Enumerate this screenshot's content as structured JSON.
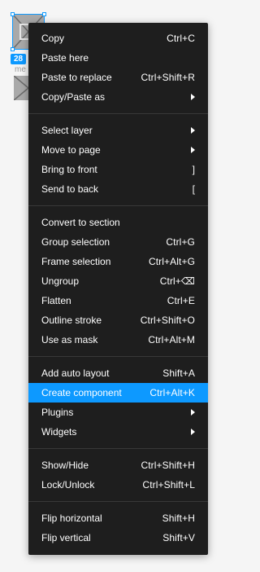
{
  "canvas": {
    "size_badge": "28",
    "layer_label": "me"
  },
  "menu": {
    "groups": [
      [
        {
          "label": "Copy",
          "shortcut": "Ctrl+C"
        },
        {
          "label": "Paste here",
          "shortcut": ""
        },
        {
          "label": "Paste to replace",
          "shortcut": "Ctrl+Shift+R"
        },
        {
          "label": "Copy/Paste as",
          "submenu": true
        }
      ],
      [
        {
          "label": "Select layer",
          "submenu": true
        },
        {
          "label": "Move to page",
          "submenu": true
        },
        {
          "label": "Bring to front",
          "shortcut": "]"
        },
        {
          "label": "Send to back",
          "shortcut": "["
        }
      ],
      [
        {
          "label": "Convert to section",
          "shortcut": ""
        },
        {
          "label": "Group selection",
          "shortcut": "Ctrl+G"
        },
        {
          "label": "Frame selection",
          "shortcut": "Ctrl+Alt+G"
        },
        {
          "label": "Ungroup",
          "shortcut": "Ctrl+⌫"
        },
        {
          "label": "Flatten",
          "shortcut": "Ctrl+E"
        },
        {
          "label": "Outline stroke",
          "shortcut": "Ctrl+Shift+O"
        },
        {
          "label": "Use as mask",
          "shortcut": "Ctrl+Alt+M"
        }
      ],
      [
        {
          "label": "Add auto layout",
          "shortcut": "Shift+A"
        },
        {
          "label": "Create component",
          "shortcut": "Ctrl+Alt+K",
          "highlighted": true
        },
        {
          "label": "Plugins",
          "submenu": true
        },
        {
          "label": "Widgets",
          "submenu": true
        }
      ],
      [
        {
          "label": "Show/Hide",
          "shortcut": "Ctrl+Shift+H"
        },
        {
          "label": "Lock/Unlock",
          "shortcut": "Ctrl+Shift+L"
        }
      ],
      [
        {
          "label": "Flip horizontal",
          "shortcut": "Shift+H"
        },
        {
          "label": "Flip vertical",
          "shortcut": "Shift+V"
        }
      ]
    ]
  },
  "colors": {
    "accent": "#0d99ff",
    "menu_bg": "#1e1e1e",
    "separator": "#383838",
    "canvas_bg": "#f5f5f5"
  }
}
